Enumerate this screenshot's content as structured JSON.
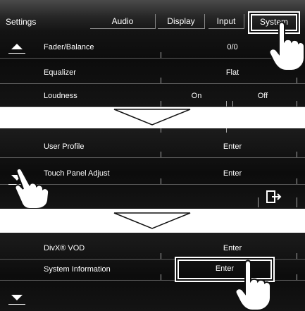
{
  "panel1": {
    "title": "Settings",
    "tabs": [
      "Audio",
      "Display",
      "Input",
      "System"
    ],
    "rows": [
      {
        "label": "Fader/Balance",
        "values": [
          "0/0"
        ]
      },
      {
        "label": "Equalizer",
        "values": [
          "Flat"
        ]
      },
      {
        "label": "Loudness",
        "values": [
          "On",
          "Off"
        ]
      }
    ]
  },
  "panel2": {
    "rows": [
      {
        "label": "User Profile",
        "values": [
          "Enter"
        ]
      },
      {
        "label": "Touch Panel Adjust",
        "values": [
          "Enter"
        ]
      }
    ]
  },
  "panel3": {
    "rows": [
      {
        "label": "DivX® VOD",
        "values": [
          "Enter"
        ]
      },
      {
        "label": "System Information",
        "values": [
          "Enter"
        ]
      }
    ]
  },
  "icons": {
    "scroll_up": "triangle-up-icon",
    "scroll_down": "triangle-down-icon",
    "exit": "exit-icon",
    "hand": "pointing-hand-icon",
    "flow": "down-arrow-outline-icon"
  }
}
